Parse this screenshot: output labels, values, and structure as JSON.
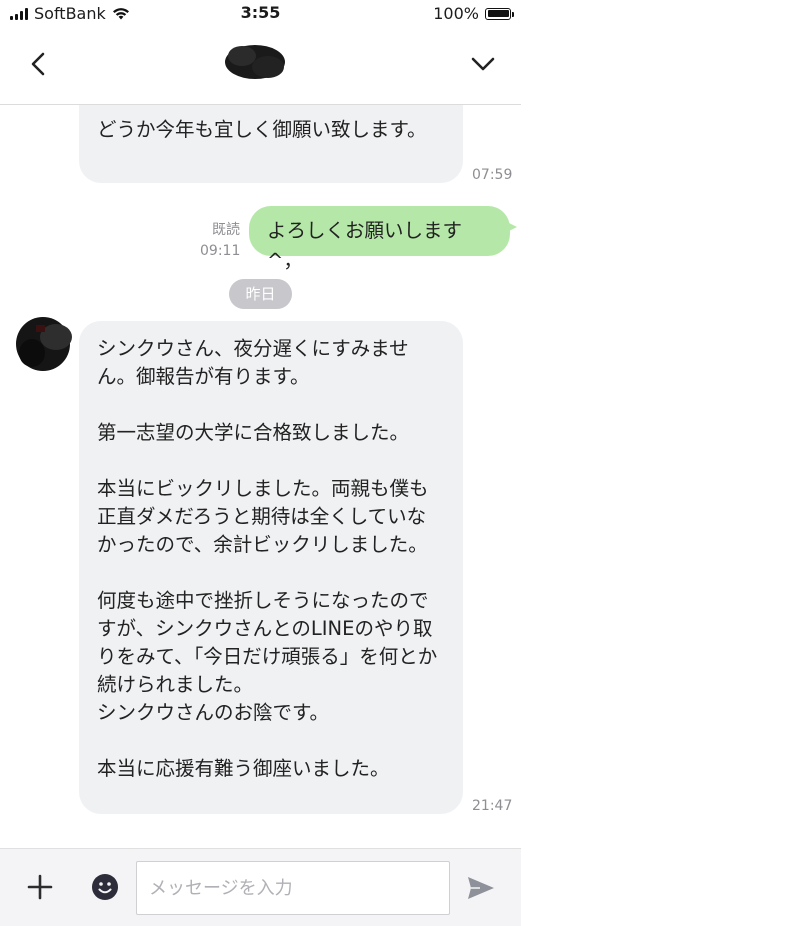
{
  "status_bar": {
    "carrier": "SoftBank",
    "time": "3:55",
    "battery": "100%"
  },
  "header": {
    "contact_name": "",
    "back_icon": "chevron-left-icon",
    "collapse_icon": "chevron-down-icon"
  },
  "messages": [
    {
      "direction": "incoming",
      "text": "どうか今年も宜しく御願い致します。",
      "time": "07:59"
    },
    {
      "direction": "outgoing",
      "text": "よろしくお願いします^，",
      "read_label": "既読",
      "time": "09:11"
    },
    {
      "direction": "incoming",
      "text": "シンクウさん、夜分遅くにすみません。御報告が有ります。\n\n第一志望の大学に合格致しました。\n\n本当にビックリしました。両親も僕も正直ダメだろうと期待は全くしていなかったので、余計ビックリしました。\n\n何度も途中で挫折しそうになったのですが、シンクウさんとのLINEのやり取りをみて、「今日だけ頑張る」を何とか続けられました。\nシンクウさんのお陰です。\n\n本当に応援有難う御座いました。",
      "time": "21:47"
    }
  ],
  "date_separator": "昨日",
  "composer": {
    "placeholder": "メッセージを入力",
    "value": "",
    "plus_icon": "plus-icon",
    "emoji_icon": "emoji-icon",
    "send_icon": "send-icon"
  },
  "colors": {
    "outgoing_bubble": "#b5e8a8",
    "incoming_bubble": "#f0f1f3",
    "date_pill": "#c7c7cc"
  }
}
